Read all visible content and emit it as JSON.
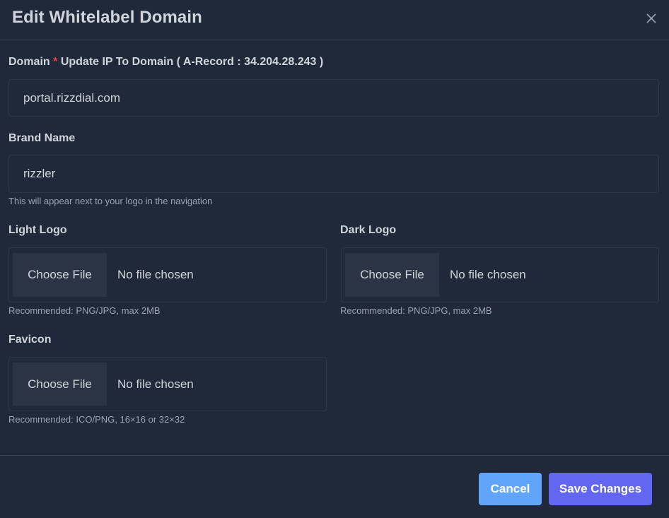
{
  "modal": {
    "title": "Edit Whitelabel Domain",
    "close_icon": "close-icon"
  },
  "domain": {
    "label": "Domain",
    "required_mark": "*",
    "note": "Update IP To Domain ( A-Record : 34.204.28.243 )",
    "value": "portal.rizzdial.com"
  },
  "brand": {
    "label": "Brand Name",
    "value": "rizzler",
    "hint": "This will appear next to your logo in the navigation"
  },
  "light_logo": {
    "label": "Light Logo",
    "button": "Choose File",
    "status": "No file chosen",
    "hint": "Recommended: PNG/JPG, max 2MB"
  },
  "dark_logo": {
    "label": "Dark Logo",
    "button": "Choose File",
    "status": "No file chosen",
    "hint": "Recommended: PNG/JPG, max 2MB"
  },
  "favicon": {
    "label": "Favicon",
    "button": "Choose File",
    "status": "No file chosen",
    "hint": "Recommended: ICO/PNG, 16×16 or 32×32"
  },
  "footer": {
    "cancel": "Cancel",
    "save": "Save Changes"
  },
  "colors": {
    "background": "#1f293a",
    "required": "#ef4444",
    "cancel_button": "#60a5fa",
    "save_button": "#6366f1"
  }
}
